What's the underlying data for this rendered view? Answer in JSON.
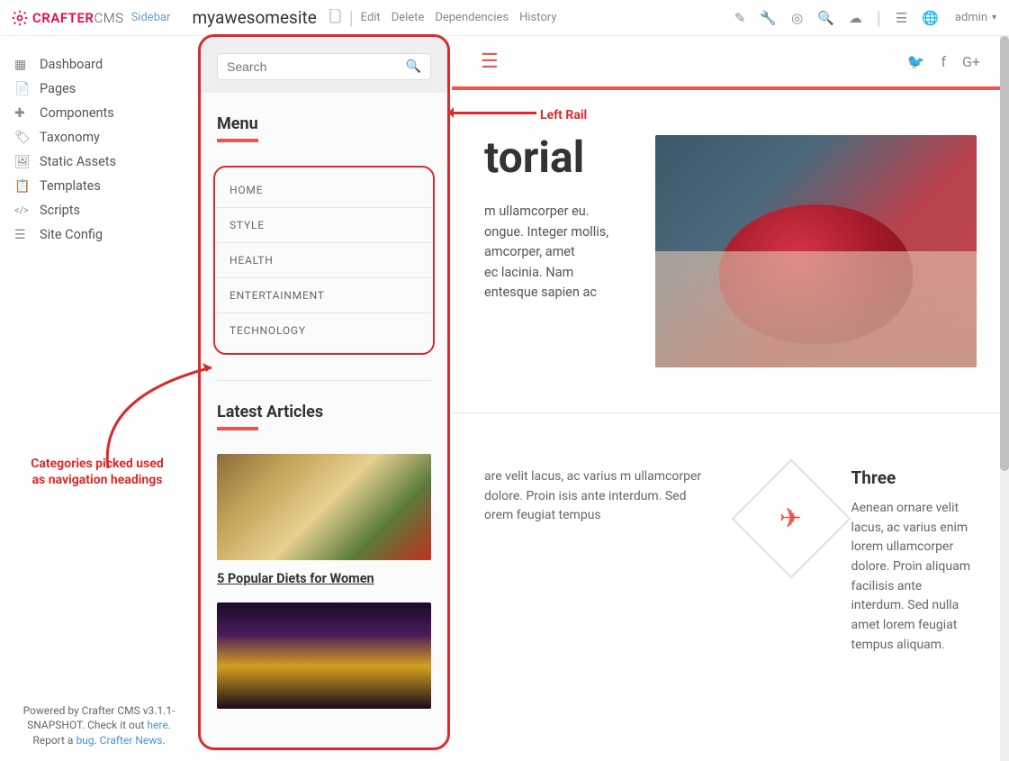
{
  "topbar": {
    "brand": "CRAFTER",
    "brand_suffix": "CMS",
    "sidebar_label": "Sidebar",
    "sitename": "myawesomesite",
    "actions": [
      "Edit",
      "Delete",
      "Dependencies",
      "History"
    ],
    "user": "admin"
  },
  "leftnav": {
    "items": [
      {
        "icon": "◫",
        "label": "Dashboard"
      },
      {
        "icon": "📄",
        "label": "Pages"
      },
      {
        "icon": "🧩",
        "label": "Components"
      },
      {
        "icon": "🏷",
        "label": "Taxonomy"
      },
      {
        "icon": "🖼",
        "label": "Static Assets"
      },
      {
        "icon": "📋",
        "label": "Templates"
      },
      {
        "icon": "</>",
        "label": "Scripts"
      },
      {
        "icon": "⚙",
        "label": "Site Config"
      }
    ]
  },
  "footer": {
    "line1": "Powered by Crafter CMS v3.1.1-SNAPSHOT. Check it out ",
    "link1": "here",
    "mid": ". Report a ",
    "link2": "bug",
    "sep": ". ",
    "link3": "Crafter News",
    "end": "."
  },
  "rail": {
    "search_placeholder": "Search",
    "menu_heading": "Menu",
    "menu_items": [
      "HOME",
      "STYLE",
      "HEALTH",
      "ENTERTAINMENT",
      "TECHNOLOGY"
    ],
    "latest_heading": "Latest Articles",
    "articles": [
      {
        "title": "5 Popular Diets for Women"
      }
    ]
  },
  "preview": {
    "hero_title_suffix": "torial",
    "hero_body_lines": [
      "m ullamcorper eu.",
      "ongue. Integer mollis,",
      "amcorper, amet",
      "ec lacinia. Nam",
      "entesque sapien ac"
    ],
    "feature_body": "are velit lacus, ac varius m ullamcorper dolore. Proin isis ante interdum. Sed orem feugiat tempus",
    "feature3_title": "Three",
    "feature3_body": "Aenean ornare velit lacus, ac varius enim lorem ullamcorper dolore. Proin aliquam facilisis ante interdum. Sed nulla amet lorem feugiat tempus aliquam."
  },
  "annotations": {
    "leftrail": "Left Rail",
    "categories": "Categories picked used as navigation headings"
  }
}
